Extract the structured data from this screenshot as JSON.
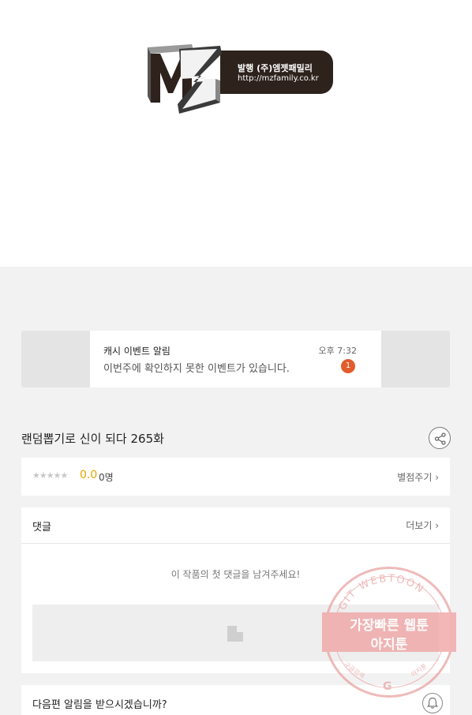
{
  "publisher": {
    "logo_text": "MZ",
    "publisher_line": "발행 (주)엠젯패밀리",
    "url_line": "http://mzfamily.co.kr"
  },
  "banner": {
    "title": "캐시 이벤트 알림",
    "time": "오후 7:32",
    "message": "이번주에 확인하지 못한 이벤트가 있습니다.",
    "count": "1"
  },
  "episode": {
    "title": "랜덤뽑기로 신이 되다 265화",
    "share_icon": "share-icon"
  },
  "rating": {
    "stars": "★★★★★",
    "score": "0.0",
    "count": "0명",
    "rate_link": "별점주기 ›"
  },
  "comments": {
    "title": "댓글",
    "more_link": "더보기 ›",
    "empty_message": "이 작품의 첫 댓글을 남겨주세요!",
    "input_icon": "pencil-icon"
  },
  "notify": {
    "question": "다음편 알림을 받으시겠습니까?",
    "bell_icon": "bell-icon"
  },
  "watermark": {
    "arc_text": "AGIT WEBTOON",
    "line1": "가장빠른 웹툰",
    "line2": "아지툰",
    "bottom_left": "구글검색",
    "bottom_right": "아지툰",
    "g_mark": "G"
  },
  "colors": {
    "accent_orange": "#e25c2c",
    "score_gold": "#e6a300",
    "watermark_pink": "#e9a3a3"
  }
}
